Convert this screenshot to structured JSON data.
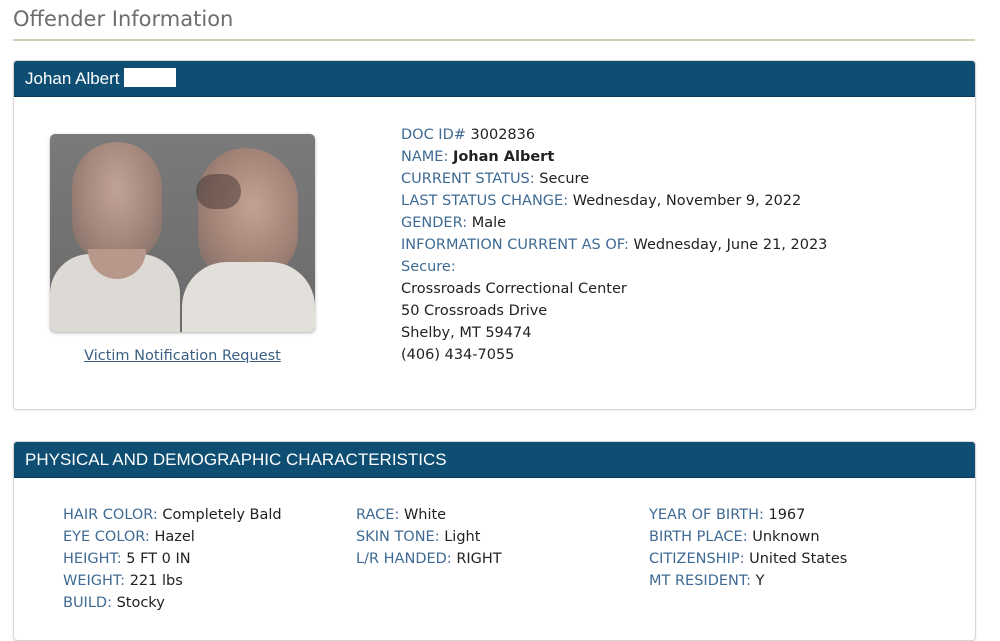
{
  "page_title": "Offender Information",
  "offender_panel": {
    "header_name": "Johan Albert",
    "victim_link": "Victim Notification Request",
    "fields": {
      "doc_id": {
        "label": "DOC ID#",
        "value": "3002836"
      },
      "name": {
        "label": "NAME:",
        "value": "Johan Albert"
      },
      "current_status": {
        "label": "CURRENT STATUS:",
        "value": "Secure"
      },
      "last_status_change": {
        "label": "LAST STATUS CHANGE:",
        "value": "Wednesday, November 9, 2022"
      },
      "gender": {
        "label": "GENDER:",
        "value": "Male"
      },
      "info_current": {
        "label": "INFORMATION CURRENT AS OF:",
        "value": "Wednesday, June 21, 2023"
      },
      "secure_label": "Secure:"
    },
    "facility": [
      "Crossroads Correctional Center",
      "50 Crossroads Drive",
      "Shelby, MT 59474",
      "(406) 434-7055"
    ]
  },
  "physical_panel": {
    "header": "PHYSICAL AND DEMOGRAPHIC CHARACTERISTICS",
    "col1": [
      {
        "label": "HAIR COLOR:",
        "value": "Completely Bald"
      },
      {
        "label": "EYE COLOR:",
        "value": "Hazel"
      },
      {
        "label": "HEIGHT:",
        "value": "5 FT 0 IN"
      },
      {
        "label": "WEIGHT:",
        "value": "221 lbs"
      },
      {
        "label": "BUILD:",
        "value": "Stocky"
      }
    ],
    "col2": [
      {
        "label": "RACE:",
        "value": "White"
      },
      {
        "label": "SKIN TONE:",
        "value": "Light"
      },
      {
        "label": "L/R HANDED:",
        "value": "RIGHT"
      }
    ],
    "col3": [
      {
        "label": "YEAR OF BIRTH:",
        "value": "1967"
      },
      {
        "label": "BIRTH PLACE:",
        "value": "Unknown"
      },
      {
        "label": "CITIZENSHIP:",
        "value": "United States"
      },
      {
        "label": "MT RESIDENT:",
        "value": "Y"
      }
    ]
  },
  "colors": {
    "header_bg": "#0f4e73",
    "label": "#3f6a93",
    "link": "#3a5f84"
  }
}
